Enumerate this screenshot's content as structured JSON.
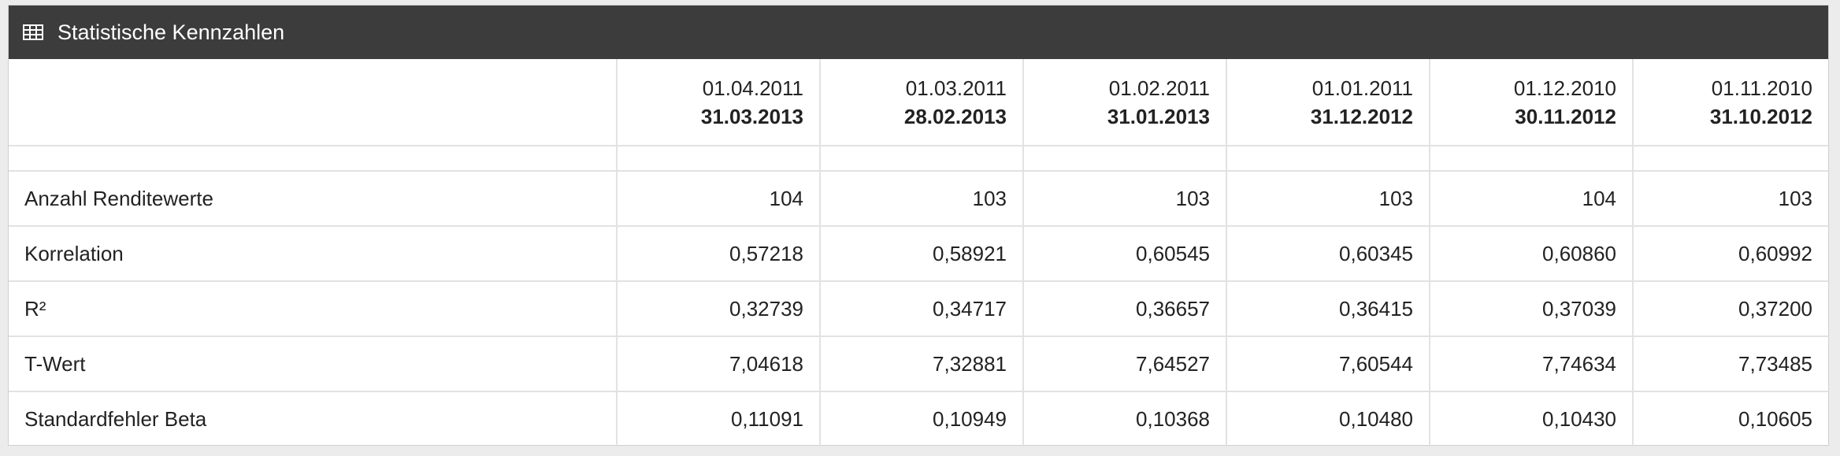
{
  "panel": {
    "icon": "table-grid-icon",
    "title": "Statistische Kennzahlen",
    "header_bg": "#3c3c3c"
  },
  "periods": [
    {
      "from": "01.04.2011",
      "to": "31.03.2013"
    },
    {
      "from": "01.03.2011",
      "to": "28.02.2013"
    },
    {
      "from": "01.02.2011",
      "to": "31.01.2013"
    },
    {
      "from": "01.01.2011",
      "to": "31.12.2012"
    },
    {
      "from": "01.12.2010",
      "to": "30.11.2012"
    },
    {
      "from": "01.11.2010",
      "to": "31.10.2012"
    }
  ],
  "rows": [
    {
      "label": "Anzahl Renditewerte",
      "values": [
        "104",
        "103",
        "103",
        "103",
        "104",
        "103"
      ]
    },
    {
      "label": "Korrelation",
      "values": [
        "0,57218",
        "0,58921",
        "0,60545",
        "0,60345",
        "0,60860",
        "0,60992"
      ]
    },
    {
      "label": "R²",
      "values": [
        "0,32739",
        "0,34717",
        "0,36657",
        "0,36415",
        "0,37039",
        "0,37200"
      ]
    },
    {
      "label": "T-Wert",
      "values": [
        "7,04618",
        "7,32881",
        "7,64527",
        "7,60544",
        "7,74634",
        "7,73485"
      ]
    },
    {
      "label": "Standardfehler Beta",
      "values": [
        "0,11091",
        "0,10949",
        "0,10368",
        "0,10480",
        "0,10430",
        "0,10605"
      ]
    }
  ]
}
